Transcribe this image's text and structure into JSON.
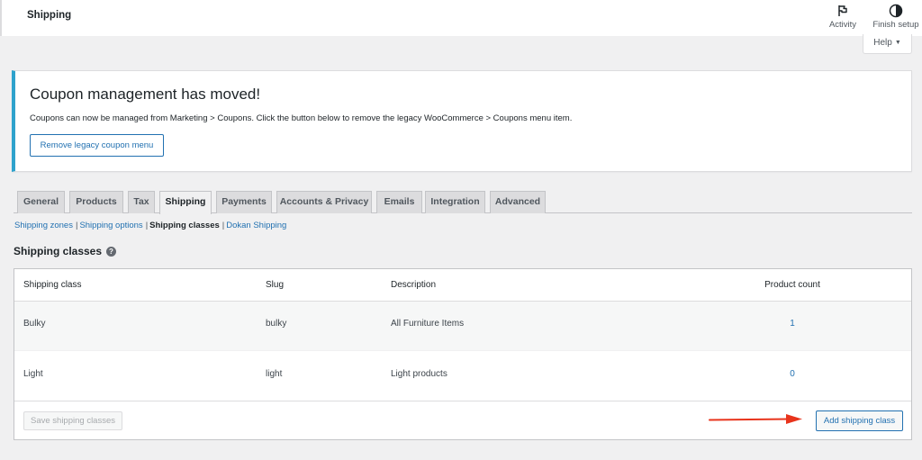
{
  "header": {
    "title": "Shipping",
    "activity_label": "Activity",
    "finish_setup_label": "Finish setup"
  },
  "help": {
    "label": "Help"
  },
  "notice": {
    "heading": "Coupon management has moved!",
    "body": "Coupons can now be managed from Marketing > Coupons. Click the button below to remove the legacy WooCommerce > Coupons menu item.",
    "button_label": "Remove legacy coupon menu",
    "accent_color": "#2ea2cc"
  },
  "tabs": [
    {
      "label": "General",
      "active": false
    },
    {
      "label": "Products",
      "active": false
    },
    {
      "label": "Tax",
      "active": false
    },
    {
      "label": "Shipping",
      "active": true
    },
    {
      "label": "Payments",
      "active": false
    },
    {
      "label": "Accounts & Privacy",
      "active": false
    },
    {
      "label": "Emails",
      "active": false
    },
    {
      "label": "Integration",
      "active": false
    },
    {
      "label": "Advanced",
      "active": false
    }
  ],
  "subnav": [
    {
      "label": "Shipping zones",
      "current": false
    },
    {
      "label": "Shipping options",
      "current": false
    },
    {
      "label": "Shipping classes",
      "current": true
    },
    {
      "label": "Dokan Shipping",
      "current": false
    }
  ],
  "section": {
    "title": "Shipping classes",
    "help_icon": "question-circle-icon"
  },
  "table": {
    "columns": [
      "Shipping class",
      "Slug",
      "Description",
      "Product count"
    ],
    "rows": [
      {
        "name": "Bulky",
        "slug": "bulky",
        "description": "All Furniture Items",
        "count": "1"
      },
      {
        "name": "Light",
        "slug": "light",
        "description": "Light products",
        "count": "0"
      }
    ],
    "save_label": "Save shipping classes",
    "add_label": "Add shipping class"
  },
  "colors": {
    "link": "#2271b1",
    "annotation_arrow": "#e8341c"
  }
}
